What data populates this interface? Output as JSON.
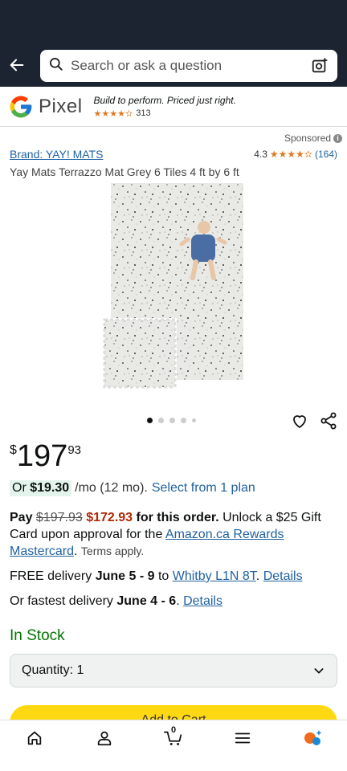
{
  "search": {
    "placeholder": "Search or ask a question"
  },
  "ad": {
    "brand_word": "Pixel",
    "tagline": "Build to perform. Priced just right.",
    "stars": "★★★★✫",
    "review_count": "313"
  },
  "product": {
    "sponsored_label": "Sponsored",
    "brand_link": "Brand: YAY! MATS",
    "rating_value": "4.3",
    "stars": "★★★★✫",
    "review_count": "(164)",
    "title": "Yay Mats Terrazzo Mat Grey 6 Tiles 4 ft by 6 ft",
    "carousel_count": 5,
    "carousel_active_index": 0
  },
  "price": {
    "currency": "$",
    "whole": "197",
    "fraction": "93"
  },
  "monthly": {
    "prefix": "Or ",
    "amount": "$19.30",
    "suffix": "/mo (12 mo).",
    "link": "Select from 1 plan"
  },
  "gift": {
    "pay": "Pay ",
    "old_price": "$197.93",
    "new_price": "$172.93",
    "for_order": " for this order.",
    "text": " Unlock a $25 Gift Card upon approval for the ",
    "link": "Amazon.ca Rewards Mastercard",
    "terms": "Terms apply."
  },
  "delivery": {
    "free_label": "FREE delivery ",
    "free_dates": "June 5 - 9",
    "to": " to ",
    "location": "Whitby L1N 8T",
    "details": "Details",
    "fastest_label": "Or fastest delivery ",
    "fastest_dates": "June 4 - 6",
    "fastest_sep": ". "
  },
  "stock": {
    "label": "In Stock"
  },
  "quantity": {
    "label": "Quantity: 1"
  },
  "add_to_cart": {
    "label": "Add to Cart"
  },
  "nav": {
    "items": [
      "home-icon",
      "account-icon",
      "cart-icon",
      "menu-icon",
      "rufus-icon"
    ],
    "cart_count": "0"
  },
  "colors": {
    "header_bg": "#1b2430",
    "link": "#2162a1",
    "price_red": "#b12704",
    "stock_green": "#007600",
    "star": "#de7921",
    "add_to_cart": "#ffd814"
  }
}
